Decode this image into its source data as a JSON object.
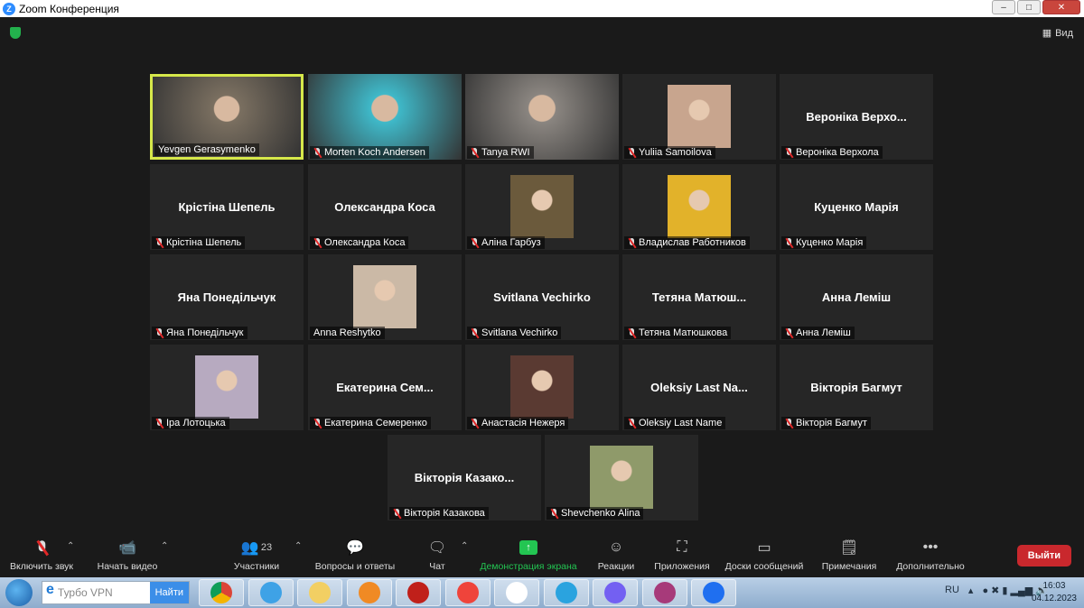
{
  "window": {
    "title": "Zoom Конференция",
    "logo": "Z"
  },
  "header": {
    "view_label": "Вид",
    "view_icon": "grid-icon",
    "security_icon": "shield-icon"
  },
  "participants": [
    {
      "big": "",
      "label": "Yevgen Gerasymenko",
      "type": "video",
      "muted": false,
      "active": true,
      "bg": "#7a6f60"
    },
    {
      "big": "",
      "label": "Morten Koch Andersen",
      "type": "video",
      "muted": true,
      "bg": "#3fb9c9"
    },
    {
      "big": "",
      "label": "Tanya RWI",
      "type": "video",
      "muted": true,
      "bg": "#8a8580"
    },
    {
      "big": "",
      "label": "Yuliia Samoilova",
      "type": "avatar",
      "muted": true,
      "bg": "#c8a58e"
    },
    {
      "big": "Вероніка  Верхо...",
      "label": "Вероніка Верхола",
      "type": "name",
      "muted": true
    },
    {
      "big": "Крістіна Шепель",
      "label": "Крістіна Шепель",
      "type": "name",
      "muted": true
    },
    {
      "big": "Олександра Коса",
      "label": "Олександра Коса",
      "type": "name",
      "muted": true
    },
    {
      "big": "",
      "label": "Аліна Гарбуз",
      "type": "avatar",
      "muted": true,
      "bg": "#6b5a3c"
    },
    {
      "big": "",
      "label": "Владислав Работников",
      "type": "avatar",
      "muted": true,
      "bg": "#e2b22a"
    },
    {
      "big": "Куценко Марія",
      "label": "Куценко Марія",
      "type": "name",
      "muted": true
    },
    {
      "big": "Яна Понедільчук",
      "label": "Яна Понедільчук",
      "type": "name",
      "muted": true
    },
    {
      "big": "",
      "label": "Anna Reshytko",
      "type": "avatar",
      "muted": false,
      "bg": "#cbb9a6"
    },
    {
      "big": "Svitlana Vechirko",
      "label": "Svitlana Vechirko",
      "type": "name",
      "muted": true
    },
    {
      "big": "Тетяна  Матюш...",
      "label": "Тетяна Матюшкова",
      "type": "name",
      "muted": true
    },
    {
      "big": "Анна Леміш",
      "label": "Анна Леміш",
      "type": "name",
      "muted": true
    },
    {
      "big": "",
      "label": "Іра Лотоцька",
      "type": "avatar",
      "muted": true,
      "bg": "#b7aac0"
    },
    {
      "big": "Екатерина  Сем...",
      "label": "Екатерина Семеренко",
      "type": "name",
      "muted": true
    },
    {
      "big": "",
      "label": "Анастасія Нежеря",
      "type": "avatar",
      "muted": true,
      "bg": "#5a3a32"
    },
    {
      "big": "Oleksiy  Last  Na...",
      "label": "Oleksiy Last Name",
      "type": "name",
      "muted": true
    },
    {
      "big": "Вікторія Багмут",
      "label": "Вікторія Багмут",
      "type": "name",
      "muted": true
    },
    {
      "big": "Вікторія  Казако...",
      "label": "Вікторія Казакова",
      "type": "name",
      "muted": true
    },
    {
      "big": "",
      "label": "Shevchenko Alina",
      "type": "avatar",
      "muted": true,
      "bg": "#8f9a6a"
    }
  ],
  "toolbar": {
    "unmute": "Включить звук",
    "video": "Начать видео",
    "participants": "Участники",
    "participants_count": "23",
    "qa": "Вопросы и ответы",
    "chat": "Чат",
    "share": "Демонстрация экрана",
    "reactions": "Реакции",
    "apps": "Приложения",
    "whiteboards": "Доски сообщений",
    "notes": "Примечания",
    "more": "Дополнительно",
    "leave": "Выйти"
  },
  "taskbar": {
    "search_placeholder": "Турбо VPN",
    "search_button": "Найти",
    "lang": "RU",
    "time": "16:03",
    "date": "04.12.2023",
    "apps": [
      "chrome",
      "internet-explorer",
      "file-explorer",
      "media-player",
      "game-app",
      "anydesk",
      "document",
      "telegram",
      "viber",
      "winrar",
      "zoom"
    ]
  }
}
